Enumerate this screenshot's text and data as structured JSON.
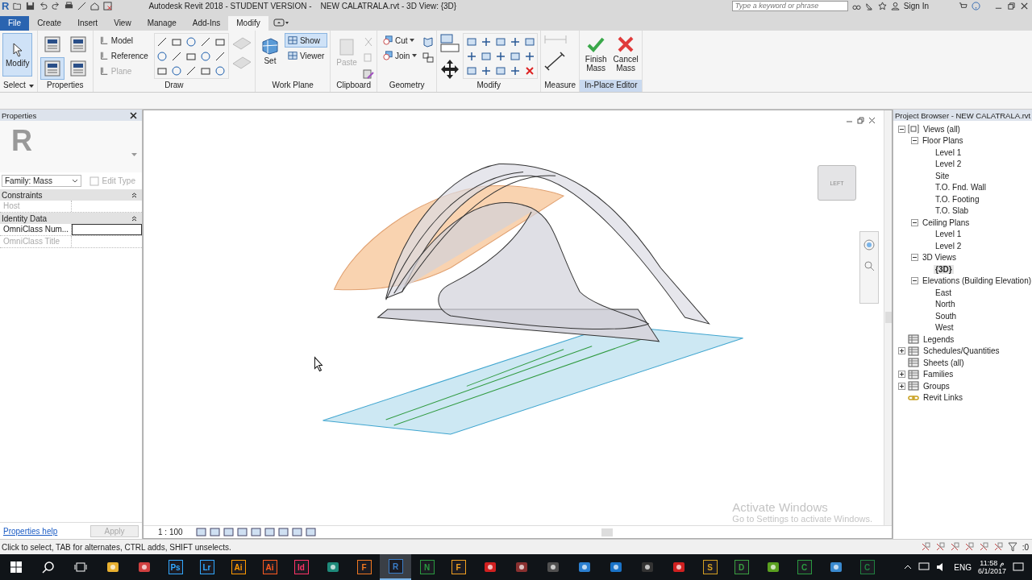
{
  "title_bar": {
    "app_logo": "R",
    "title": "Autodesk Revit 2018 - STUDENT VERSION -    NEW CALATRALA.rvt - 3D View: {3D}",
    "search": {
      "placeholder": "Type a keyword or phrase"
    },
    "sign_in": "Sign In"
  },
  "tabs": [
    {
      "label": "File",
      "kind": "file",
      "selected": false
    },
    {
      "label": "Create",
      "kind": "tab",
      "selected": false
    },
    {
      "label": "Insert",
      "kind": "tab",
      "selected": false
    },
    {
      "label": "View",
      "kind": "tab",
      "selected": false
    },
    {
      "label": "Manage",
      "kind": "tab",
      "selected": false
    },
    {
      "label": "Add-Ins",
      "kind": "tab",
      "selected": false
    },
    {
      "label": "Modify",
      "kind": "tab",
      "selected": true
    }
  ],
  "ribbon": [
    {
      "kind": "select",
      "label": "Select",
      "tools": [
        {
          "label": "Modify",
          "selected": true
        }
      ]
    },
    {
      "kind": "properties",
      "label": "Properties",
      "tools": [
        {
          "selected": false
        },
        {
          "selected": false
        },
        {
          "selected": true
        },
        {
          "selected": false
        }
      ]
    },
    {
      "kind": "draw",
      "label": "Draw",
      "tools": [
        {
          "label": "Model",
          "disabled": false
        },
        {
          "label": "Reference",
          "disabled": false
        },
        {
          "label": "Plane",
          "disabled": true
        }
      ]
    },
    {
      "kind": "workplane",
      "label": "Work Plane",
      "tools": [
        {
          "label": "Set",
          "selected": false
        },
        {
          "label": "Show",
          "selected": true
        },
        {
          "label": "Viewer",
          "selected": false
        }
      ]
    },
    {
      "kind": "clipboard",
      "label": "Clipboard",
      "tools": [
        {
          "label": "Paste",
          "disabled": true
        }
      ]
    },
    {
      "kind": "geometry",
      "label": "Geometry",
      "tools": [
        {
          "label": "Cut"
        },
        {
          "label": "Join"
        }
      ]
    },
    {
      "kind": "modify",
      "label": "Modify"
    },
    {
      "kind": "measure",
      "label": "Measure"
    },
    {
      "kind": "editor",
      "label": "In-Place Editor",
      "tools": [
        {
          "label": "Finish Mass",
          "kind": "finish"
        },
        {
          "label": "Cancel Mass",
          "kind": "cancel"
        }
      ]
    }
  ],
  "properties": {
    "title": "Properties",
    "type_logo": "R",
    "type_selector": "Family: Mass",
    "edit_type": {
      "label": "Edit Type",
      "disabled": true
    },
    "groups": [
      {
        "title": "Constraints",
        "expanded": true,
        "rows": [
          {
            "name": "Host",
            "disabled": true,
            "editing": false
          }
        ]
      },
      {
        "title": "Identity Data",
        "expanded": true,
        "rows": [
          {
            "name": "OmniClass Num...",
            "disabled": false,
            "editing": true
          },
          {
            "name": "OmniClass Title",
            "disabled": true,
            "editing": false
          }
        ]
      }
    ],
    "help_link": "Properties help",
    "apply": {
      "label": "Apply",
      "disabled": true
    }
  },
  "viewport": {
    "view_cube": {
      "face": "LEFT"
    },
    "scale": "1 : 100",
    "notice": {
      "title": "Activate Windows",
      "subtitle": "Go to Settings to activate Windows."
    }
  },
  "project_browser": {
    "title": "Project Browser - NEW CALATRALA.rvt",
    "tree": [
      {
        "label": "Views (all)",
        "kind": "views",
        "expanded": true,
        "selected": false,
        "children": [
          {
            "label": "Floor Plans",
            "expanded": true,
            "selected": false,
            "children": [
              {
                "label": "Level 1",
                "selected": false
              },
              {
                "label": "Level 2",
                "selected": false
              },
              {
                "label": "Site",
                "selected": false
              },
              {
                "label": "T.O. Fnd. Wall",
                "selected": false
              },
              {
                "label": "T.O. Footing",
                "selected": false
              },
              {
                "label": "T.O. Slab",
                "selected": false
              }
            ]
          },
          {
            "label": "Ceiling Plans",
            "expanded": true,
            "selected": false,
            "children": [
              {
                "label": "Level 1",
                "selected": false
              },
              {
                "label": "Level 2",
                "selected": false
              }
            ]
          },
          {
            "label": "3D Views",
            "expanded": true,
            "selected": false,
            "children": [
              {
                "label": "{3D}",
                "selected": true
              }
            ]
          },
          {
            "label": "Elevations (Building Elevation)",
            "expanded": true,
            "selected": false,
            "children": [
              {
                "label": "East",
                "selected": false
              },
              {
                "label": "North",
                "selected": false
              },
              {
                "label": "South",
                "selected": false
              },
              {
                "label": "West",
                "selected": false
              }
            ]
          }
        ]
      },
      {
        "label": "Legends",
        "kind": "legends",
        "selected": false
      },
      {
        "label": "Schedules/Quantities",
        "kind": "schedules",
        "expanded": false,
        "selected": false
      },
      {
        "label": "Sheets (all)",
        "kind": "sheets",
        "selected": false
      },
      {
        "label": "Families",
        "kind": "families",
        "expanded": false,
        "selected": false
      },
      {
        "label": "Groups",
        "kind": "groups",
        "expanded": false,
        "selected": false
      },
      {
        "label": "Revit Links",
        "kind": "links",
        "selected": false
      }
    ]
  },
  "status_bar": {
    "message": "Click to select, TAB for alternates, CTRL adds, SHIFT unselects.",
    "filter_count": ":0"
  },
  "taskbar": {
    "apps": [
      {
        "kind": "shape",
        "color": "#e8b030",
        "selected": false
      },
      {
        "kind": "shape",
        "color": "#d04040",
        "selected": false
      },
      {
        "kind": "letter",
        "label": "Ps",
        "color": "#31a8ff",
        "selected": false
      },
      {
        "kind": "letter",
        "label": "Lr",
        "color": "#31a8ff",
        "selected": false
      },
      {
        "kind": "letter",
        "label": "Ai",
        "color": "#ff9a00",
        "selected": false
      },
      {
        "kind": "letter",
        "label": "Ai",
        "color": "#ff5a1f",
        "selected": false
      },
      {
        "kind": "letter",
        "label": "Id",
        "color": "#ff3366",
        "selected": false
      },
      {
        "kind": "shape",
        "color": "#1e8a7a",
        "selected": false
      },
      {
        "kind": "letter",
        "label": "F",
        "color": "#f07820",
        "selected": false
      },
      {
        "kind": "letter",
        "label": "R",
        "color": "#3a7dc8",
        "selected": true
      },
      {
        "kind": "letter",
        "label": "N",
        "color": "#2a9a40",
        "selected": false
      },
      {
        "kind": "letter",
        "label": "F",
        "color": "#f0a020",
        "selected": false
      },
      {
        "kind": "shape",
        "color": "#d02020",
        "selected": false
      },
      {
        "kind": "shape",
        "color": "#8a3030",
        "selected": false
      },
      {
        "kind": "shape",
        "color": "#505050",
        "selected": false
      },
      {
        "kind": "shape",
        "color": "#2b7fd0",
        "selected": false
      },
      {
        "kind": "shape",
        "color": "#1a73c8",
        "selected": false
      },
      {
        "kind": "shape",
        "color": "#333333",
        "selected": false
      },
      {
        "kind": "shape",
        "color": "#d02020",
        "selected": false
      },
      {
        "kind": "letter",
        "label": "S",
        "color": "#d4a020",
        "selected": false
      },
      {
        "kind": "letter",
        "label": "D",
        "color": "#3aa040",
        "selected": false
      },
      {
        "kind": "shape",
        "color": "#5aa020",
        "selected": false
      },
      {
        "kind": "letter",
        "label": "C",
        "color": "#2a9a40",
        "selected": false
      },
      {
        "kind": "shape",
        "color": "#3a8ad0",
        "selected": false
      },
      {
        "kind": "letter",
        "label": "C",
        "color": "#208040",
        "selected": false
      }
    ],
    "language": "ENG",
    "time": "11:58 م",
    "date": "6/1/2017"
  }
}
